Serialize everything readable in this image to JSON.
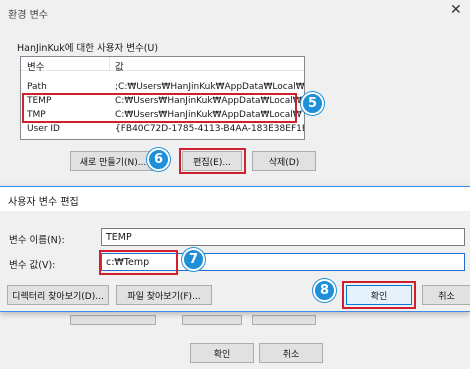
{
  "back_window": {
    "title": "환경 변수",
    "group_label": "HanJinKuk에 대한 사용자 변수(U)",
    "columns": [
      "변수",
      "값"
    ],
    "rows": [
      {
        "name": "Path",
        "value": ";C:₩Users₩HanJinKuk₩AppData₩Local₩Mi..."
      },
      {
        "name": "TEMP",
        "value": "C:₩Users₩HanJinKuk₩AppData₩Local₩Te..."
      },
      {
        "name": "TMP",
        "value": "C:₩Users₩HanJinKuk₩AppData₩Local₩Te..."
      },
      {
        "name": "User ID",
        "value": "{FB40C72D-1785-4113-B4AA-183E38EF1E..."
      }
    ],
    "buttons": {
      "new": "새로 만들기(N)...",
      "edit": "편집(E)...",
      "delete": "삭제(D)"
    },
    "bottom_buttons": {
      "ok": "확인",
      "cancel": "취소"
    }
  },
  "dialog": {
    "title": "사용자 변수 편집",
    "name_label": "변수 이름(N):",
    "name_value": "TEMP",
    "value_label": "변수 값(V):",
    "value_value": "c:₩Temp",
    "browse_dir": "디렉터리 찾아보기(D)...",
    "browse_file": "파일 찾아보기(F)...",
    "ok": "확인",
    "cancel": "취소"
  },
  "badges": {
    "b5": "5",
    "b6": "6",
    "b7": "7",
    "b8": "8"
  },
  "colors": {
    "badge": "#1e8fd8",
    "highlight": "#d02030",
    "dialog_border": "#3c8be8"
  }
}
